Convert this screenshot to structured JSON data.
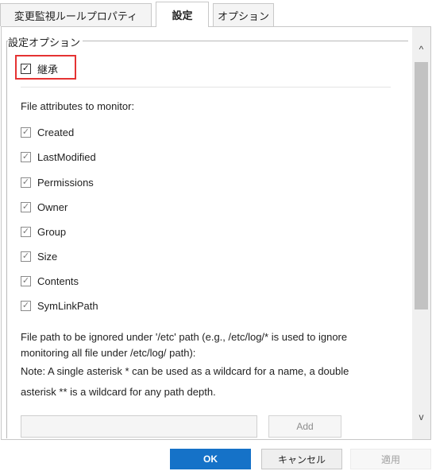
{
  "tabs": [
    {
      "label": "変更監視ルールプロパティ",
      "active": false
    },
    {
      "label": "設定",
      "active": true
    },
    {
      "label": "オプション",
      "active": false
    }
  ],
  "group": {
    "title": "設定オプション"
  },
  "inherit": {
    "label": "継承",
    "checked": true
  },
  "attributes_label": "File attributes to monitor:",
  "attributes": [
    {
      "label": "Created",
      "checked": true
    },
    {
      "label": "LastModified",
      "checked": true
    },
    {
      "label": "Permissions",
      "checked": true
    },
    {
      "label": "Owner",
      "checked": true
    },
    {
      "label": "Group",
      "checked": true
    },
    {
      "label": "Size",
      "checked": true
    },
    {
      "label": "Contents",
      "checked": true
    },
    {
      "label": "SymLinkPath",
      "checked": true
    }
  ],
  "path_help": [
    "File path to be ignored under '/etc' path (e.g., /etc/log/* is used to ignore",
    "monitoring all file under /etc/log/ path):",
    "Note: A single asterisk * can be used as a wildcard for a name, a double",
    "asterisk ** is a wildcard for any path depth."
  ],
  "path_input": {
    "value": "",
    "placeholder": ""
  },
  "add_label": "Add",
  "footer": {
    "ok": "OK",
    "cancel": "キャンセル",
    "apply": "適用"
  },
  "icons": {
    "check": "✓",
    "scroll_up": "^",
    "scroll_down": "v"
  },
  "colors": {
    "primary": "#1572c8",
    "highlight": "#e53333"
  }
}
